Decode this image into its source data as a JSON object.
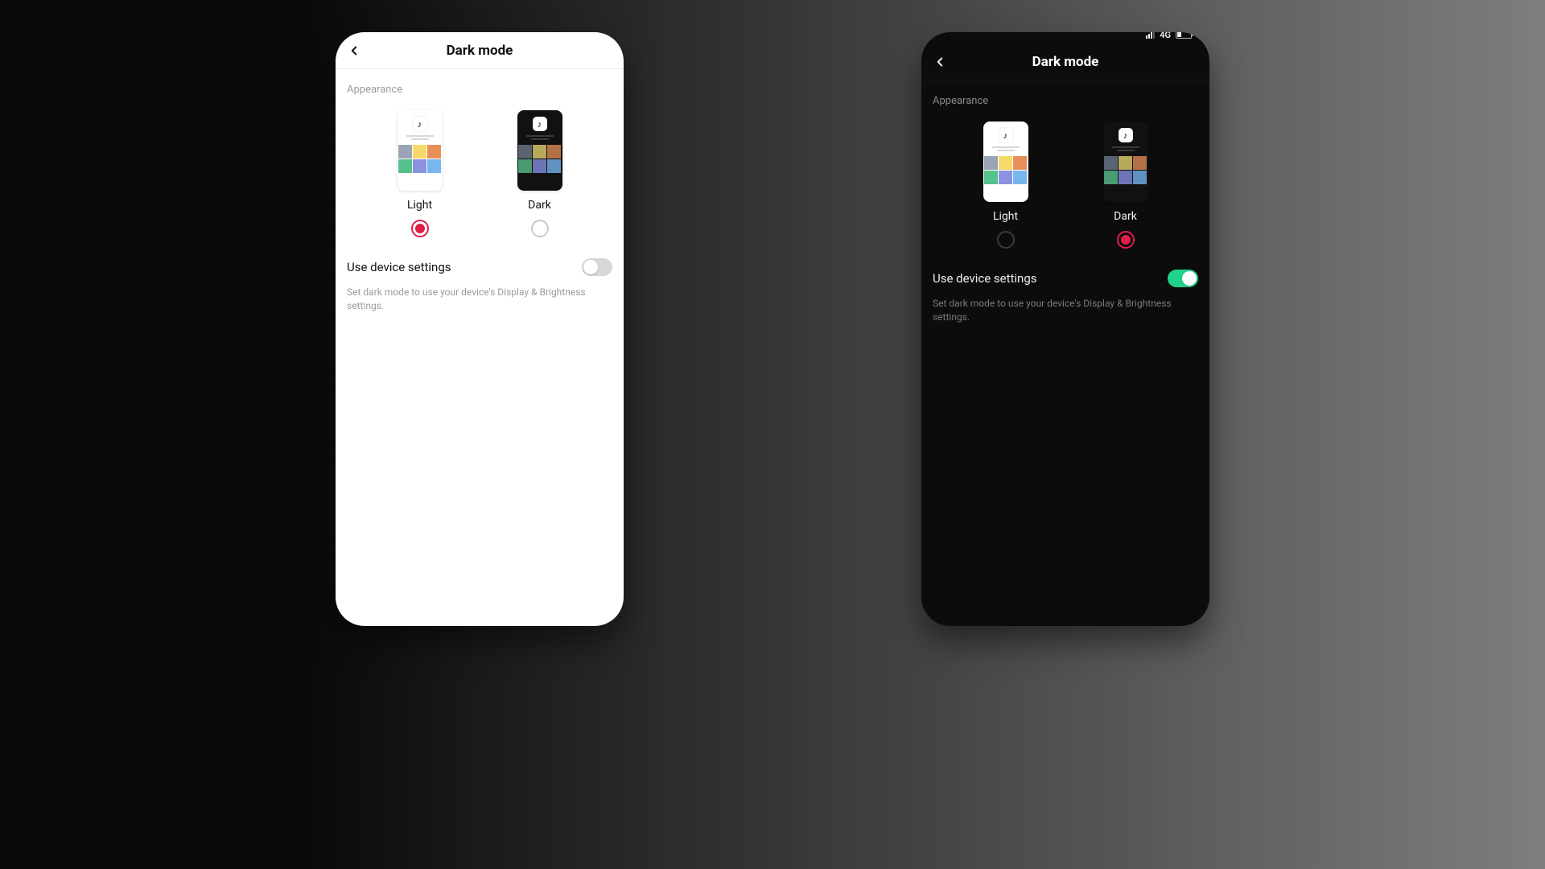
{
  "light_phone": {
    "title": "Dark mode",
    "section": "Appearance",
    "options": [
      {
        "label": "Light",
        "selected": true
      },
      {
        "label": "Dark",
        "selected": false
      }
    ],
    "use_device": {
      "label": "Use device settings",
      "on": false
    },
    "hint": "Set dark mode to use your device's Display & Brightness settings."
  },
  "dark_phone": {
    "status": {
      "network": "4G"
    },
    "title": "Dark mode",
    "section": "Appearance",
    "options": [
      {
        "label": "Light",
        "selected": false
      },
      {
        "label": "Dark",
        "selected": true
      }
    ],
    "use_device": {
      "label": "Use device settings",
      "on": true
    },
    "hint": "Set dark mode to use your device's Display & Brightness settings."
  }
}
